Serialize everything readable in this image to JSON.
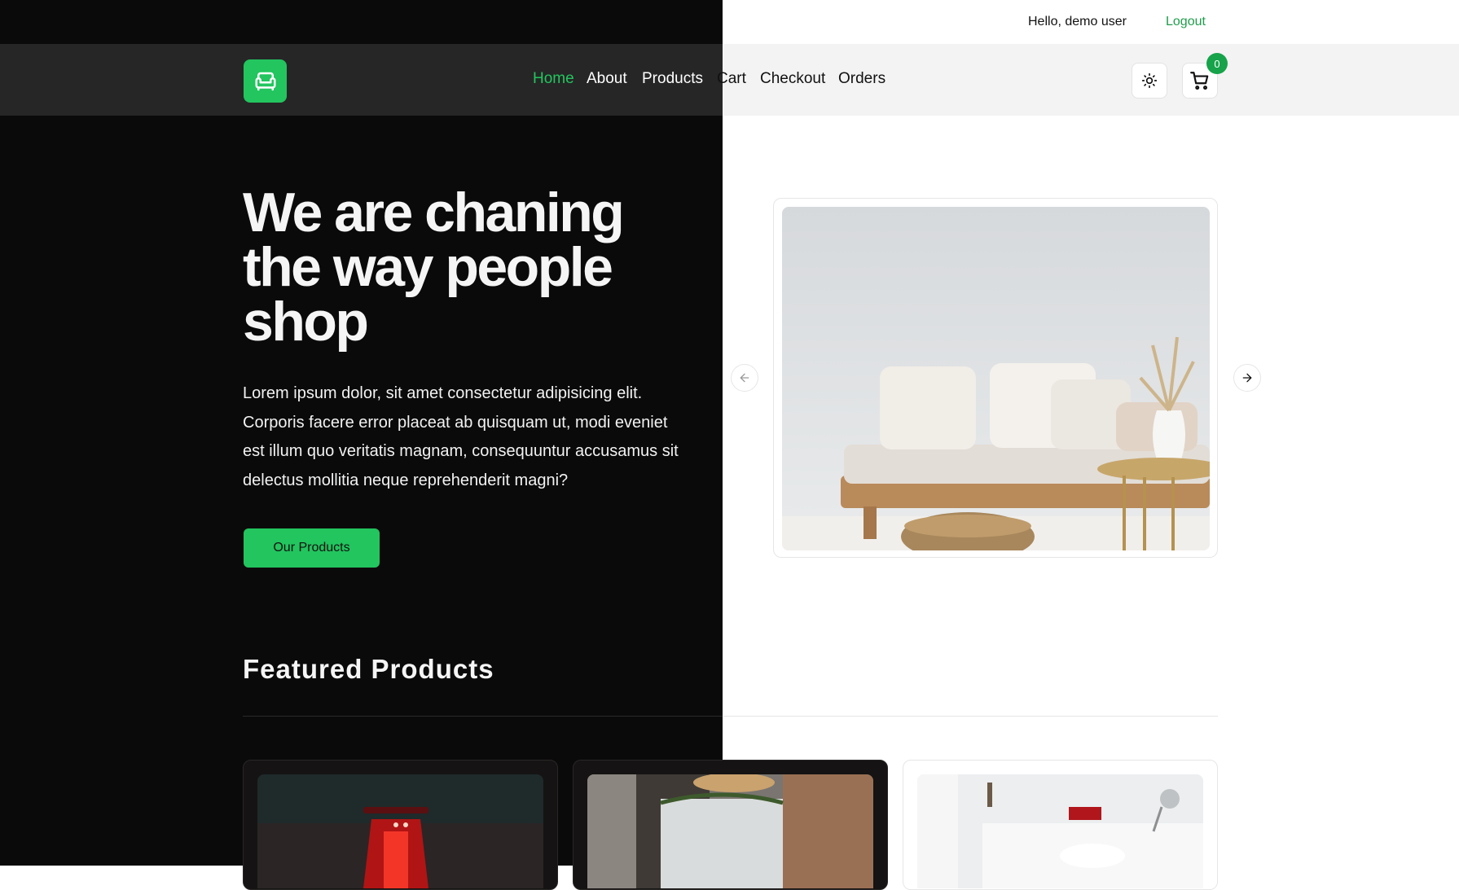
{
  "topbar": {
    "greeting": "Hello, demo user",
    "logout_label": "Logout"
  },
  "brand": {
    "logo_icon": "armchair-icon",
    "accent_color": "#22c55e"
  },
  "nav": {
    "links": [
      {
        "label": "Home",
        "active": true
      },
      {
        "label": "About",
        "active": false
      },
      {
        "label": "Products",
        "active": false
      },
      {
        "label": "Cart",
        "active": false
      },
      {
        "label": "Checkout",
        "active": false
      },
      {
        "label": "Orders",
        "active": false
      }
    ],
    "theme_toggle_icon": "sun-icon",
    "cart_icon": "shopping-cart-icon",
    "cart_count": "0"
  },
  "hero": {
    "title": "We are chaning the way people shop",
    "description": "Lorem ipsum dolor, sit amet consectetur adipisicing elit. Corporis facere error placeat ab quisquam ut, modi eveniet est illum quo veritatis magnam, consequuntur accusamus sit delectus mollitia neque reprehenderit magni?",
    "cta_label": "Our Products"
  },
  "carousel": {
    "prev_icon": "arrow-left-icon",
    "next_icon": "arrow-right-icon",
    "image": "sofa-photo"
  },
  "featured": {
    "title": "Featured Products",
    "cards": [
      {
        "image": "red-lantern-photo"
      },
      {
        "image": "dining-room-photo"
      },
      {
        "image": "white-bedroom-photo"
      }
    ]
  }
}
